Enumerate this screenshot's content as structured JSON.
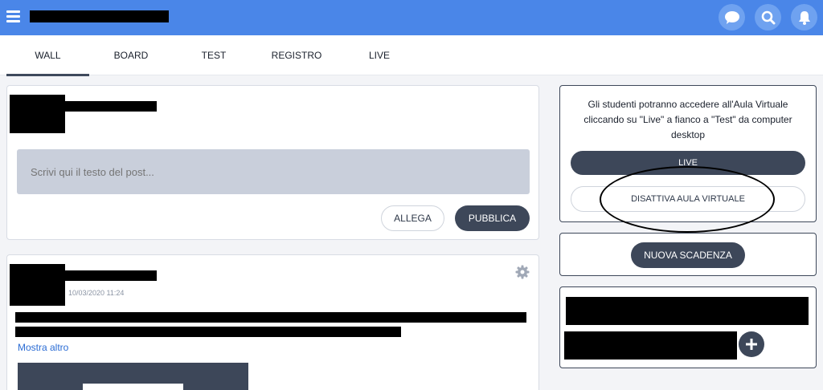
{
  "header": {
    "icons": [
      "menu-icon",
      "chat-icon",
      "search-icon",
      "bell-icon"
    ],
    "colors": {
      "bar": "#4a86e8",
      "icon_circle": "#6fa2f0"
    }
  },
  "tabs": [
    {
      "label": "WALL"
    },
    {
      "label": "BOARD"
    },
    {
      "label": "TEST"
    },
    {
      "label": "REGISTRO"
    },
    {
      "label": "LIVE"
    }
  ],
  "composer": {
    "placeholder": "Scrivi qui il testo del post...",
    "attach_label": "ALLEGA",
    "publish_label": "PUBBLICA"
  },
  "post": {
    "timestamp": "10/03/2020 11:24",
    "more_link": "Mostra altro"
  },
  "sidebar": {
    "virtual_room_info": "Gli studenti potranno accedere all'Aula Virtuale cliccando su \"Live\" a fianco a \"Test\" da computer desktop",
    "live_button": "LIVE",
    "disable_button": "DISATTIVA AULA VIRTUALE",
    "deadline_button": "NUOVA SCADENZA"
  }
}
